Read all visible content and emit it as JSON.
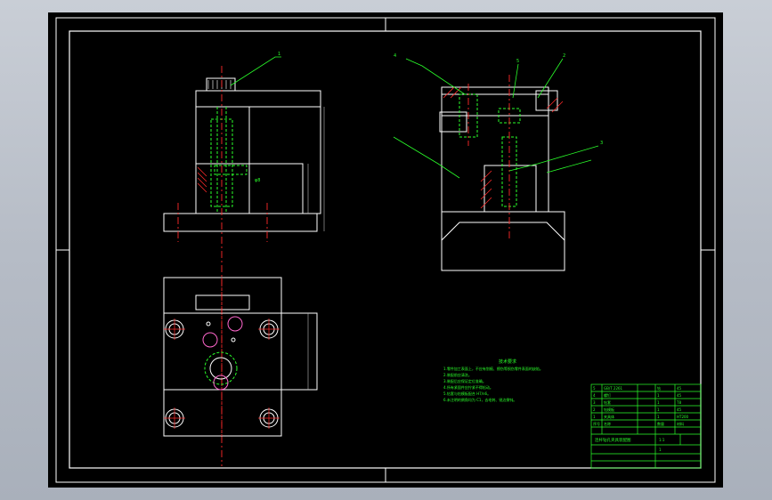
{
  "viewport": {
    "background": "#000000",
    "frame_color": "#ffffff",
    "centerline_color": "#ff2a2a",
    "hidden_line_color": "#2aff2a",
    "leader_color": "#2aff2a",
    "hatch_color": "#ff2a2a"
  },
  "views": {
    "front": {
      "leaders": [
        "1"
      ]
    },
    "section": {
      "leaders": [
        "4",
        "5",
        "2",
        "3"
      ]
    },
    "top": {
      "leaders": []
    }
  },
  "tech_notes": {
    "title": "技术要求",
    "lines": [
      "1.零件加工表面上，不应有划痕、擦伤等损伤零件表面的缺陷。",
      "2.装配前应清洗。",
      "3.装配后应保证定位准确。",
      "4.所有紧固件应拧紧不得松动。",
      "5.钻套与钻模板配合 H7/n6。",
      "6.未注明的倒角均为 C1，去毛刺、锐边倒钝。"
    ]
  },
  "title_block": {
    "rows": [
      [
        "5",
        "GB/T 2261",
        "",
        "",
        "钻",
        "45"
      ],
      [
        "4",
        "螺钉",
        "",
        "",
        "1",
        "45"
      ],
      [
        "3",
        "钻套",
        "",
        "",
        "1",
        "T8"
      ],
      [
        "2",
        "钻模板",
        "",
        "",
        "1",
        "45"
      ],
      [
        "1",
        "夹具体",
        "",
        "",
        "1",
        "HT200"
      ],
      [
        "序号",
        "名称",
        "",
        "",
        "数量",
        "材料"
      ]
    ],
    "drawing_title": "连杆钻孔夹具装配图",
    "scale": "1:1",
    "sheet": "1"
  }
}
